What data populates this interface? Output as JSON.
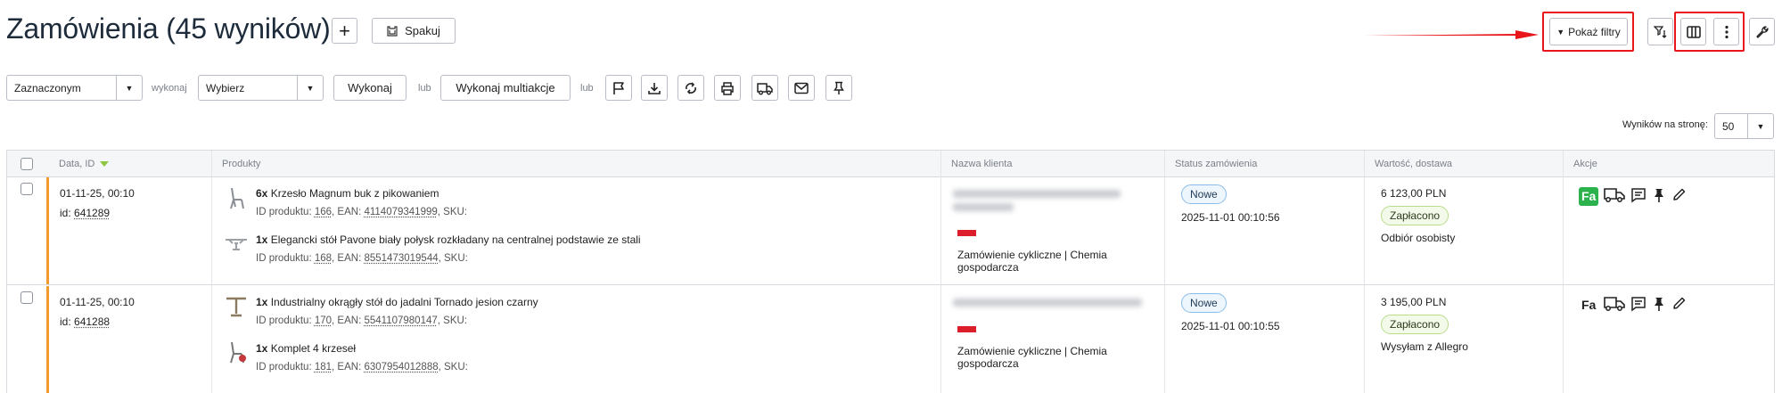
{
  "header": {
    "title": "Zamówienia (45 wyników)",
    "plus_label": "+",
    "spakuj_label": "Spakuj",
    "pokaz_filtry_label": "Pokaż filtry"
  },
  "toolbar": {
    "scope_value": "Zaznaczonym",
    "wykonaj_small": "wykonaj",
    "action_value": "Wybierz",
    "wykonaj_button": "Wykonaj",
    "lub1": "lub",
    "multi_button": "Wykonaj multiakcje",
    "lub2": "lub"
  },
  "pagination": {
    "per_page_label": "Wyników na stronę:",
    "per_page_value": "50"
  },
  "table": {
    "columns": [
      "Data, ID",
      "Produkty",
      "Nazwa klienta",
      "Status zamówienia",
      "Wartość, dostawa",
      "Akcje"
    ],
    "rows": [
      {
        "date": "01-11-25, 00:10",
        "id_prefix": "id: ",
        "id": "641289",
        "products": [
          {
            "qty": "6x",
            "name": "Krzesło Magnum buk z pikowaniem",
            "id_prefix": "ID produktu: ",
            "product_id": "166",
            "ean_prefix": ", EAN: ",
            "ean": "4114079341999",
            "sku": ", SKU:"
          },
          {
            "qty": "1x",
            "name": "Elegancki stół Pavone biały połysk rozkładany na centralnej podstawie ze stali",
            "id_prefix": "ID produktu: ",
            "product_id": "168",
            "ean_prefix": ", EAN: ",
            "ean": "8551473019544",
            "sku": ", SKU:"
          }
        ],
        "client_note": "Zamówienie cykliczne | Chemia gospodarcza",
        "status": "Nowe",
        "status_time": "2025-11-01 00:10:56",
        "value": "6 123,00 PLN",
        "payment": "Zapłacono",
        "delivery": "Odbiór osobisty",
        "invoice_active": true,
        "invoice_label": "Fa"
      },
      {
        "date": "01-11-25, 00:10",
        "id_prefix": "id: ",
        "id": "641288",
        "products": [
          {
            "qty": "1x",
            "name": "Industrialny okrągły stół do jadalni Tornado jesion czarny",
            "id_prefix": "ID produktu: ",
            "product_id": "170",
            "ean_prefix": ", EAN: ",
            "ean": "5541107980147",
            "sku": ", SKU:"
          },
          {
            "qty": "1x",
            "name": "Komplet 4 krzeseł",
            "id_prefix": "ID produktu: ",
            "product_id": "181",
            "ean_prefix": ", EAN: ",
            "ean": "6307954012888",
            "sku": ", SKU:"
          }
        ],
        "client_note": "Zamówienie cykliczne | Chemia gospodarcza",
        "status": "Nowe",
        "status_time": "2025-11-01 00:10:55",
        "value": "3 195,00 PLN",
        "payment": "Zapłacono",
        "delivery": "Wysyłam z Allegro",
        "invoice_active": false,
        "invoice_label": "Fa"
      }
    ]
  },
  "colors": {
    "accent_orange": "#f39a2e",
    "highlight_red": "#e8151b",
    "invoice_green": "#2bb24c",
    "sort_green": "#8cc63f"
  }
}
